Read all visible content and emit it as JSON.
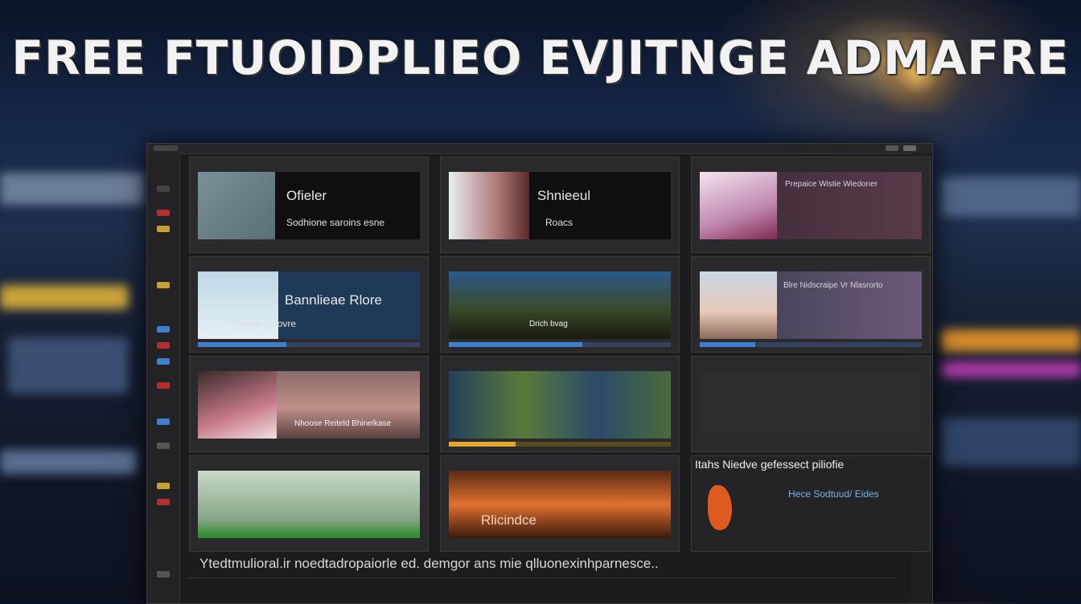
{
  "hero": {
    "headline": "FREE FTUOIDPLIEO EVJITNGE ADMAFRE"
  },
  "panels": [
    {
      "title": "Ofieler",
      "subtitle": "Sodhione saroins esne"
    },
    {
      "title": "Shnieeul",
      "subtitle": "Roacs"
    },
    {
      "subtitle": "Prepaice Wistie Wiedoner"
    },
    {
      "title": "Bannlieae Rlore",
      "subtitle": "Whoide Bhovre"
    },
    {
      "subtitle": "Drich bvag"
    },
    {
      "subtitle": "Blre Nidscraipe Vr Nlasrorto"
    },
    {
      "subtitle": "Nhoose Reiteld Bhinelkase"
    },
    {
      "subtitle": ""
    },
    {
      "subtitle": ""
    },
    {
      "subtitle": ""
    },
    {
      "title": "Rlicindce",
      "subtitle": ""
    },
    {
      "header": "Itahs Niedve gefessect piliofie",
      "subtitle": "Hece Sodtuud/ Eides"
    }
  ],
  "caption": "Ytedtmulioral.ir noedtadropaiorle ed. demgor ans mie qlluonexinhparnesce..",
  "colors": {
    "accent": "#3f7fd0",
    "panel_bg": "#2a2a2c",
    "window_bg": "#1c1c1e"
  }
}
